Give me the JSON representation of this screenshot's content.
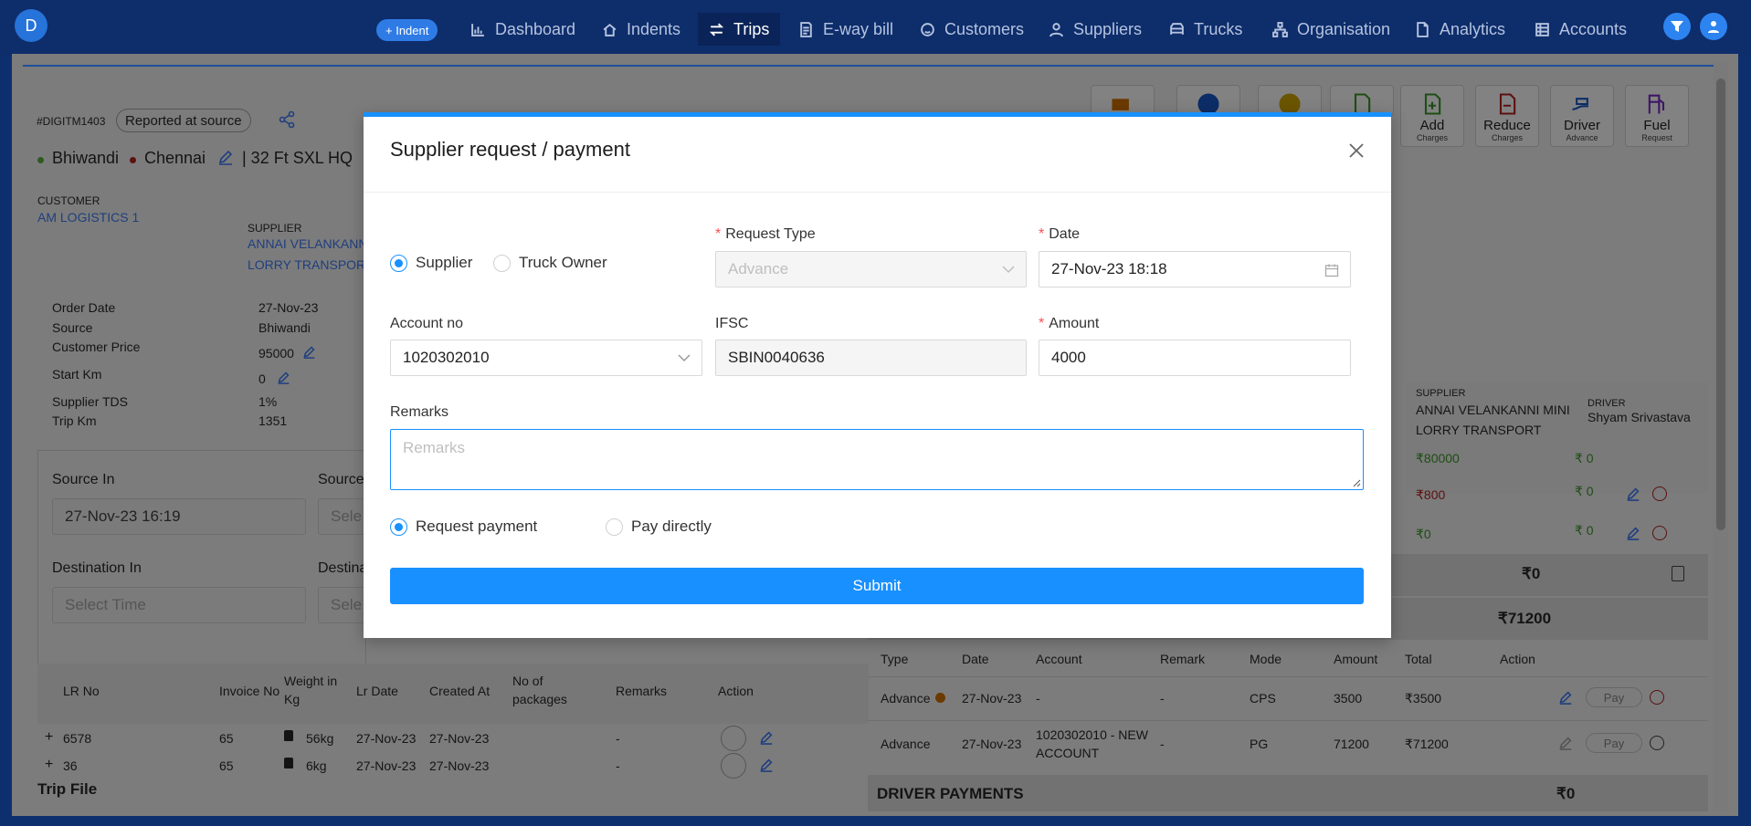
{
  "nav": {
    "avatar_letter": "D",
    "indent_button": "+ Indent",
    "items": [
      {
        "label": "Dashboard",
        "icon": "bar-chart-icon"
      },
      {
        "label": "Indents",
        "icon": "home-icon"
      },
      {
        "label": "Trips",
        "icon": "swap-icon"
      },
      {
        "label": "E-way bill",
        "icon": "document-icon"
      },
      {
        "label": "Customers",
        "icon": "smile-icon"
      },
      {
        "label": "Suppliers",
        "icon": "user-icon"
      },
      {
        "label": "Trucks",
        "icon": "truck-icon"
      },
      {
        "label": "Organisation",
        "icon": "org-icon"
      },
      {
        "label": "Analytics",
        "icon": "file-icon"
      },
      {
        "label": "Accounts",
        "icon": "table-icon"
      }
    ],
    "active": "Trips"
  },
  "trip": {
    "id": "#DIGITM1403",
    "status": "Reported at source",
    "source": "Bhiwandi",
    "destination": "Chennai",
    "truck_type": "| 32 Ft SXL HQ",
    "customer_label": "CUSTOMER",
    "customer": "AM LOGISTICS 1",
    "supplier_label": "SUPPLIER",
    "supplier_line1": "ANNAI VELANKANN",
    "supplier_line2": "LORRY TRANSPORT",
    "details": [
      {
        "label": "Order Date",
        "value": "27-Nov-23"
      },
      {
        "label": "Source",
        "value": "Bhiwandi"
      },
      {
        "label": "Customer Price",
        "value": "95000"
      },
      {
        "label": "Start Km",
        "value": "0"
      },
      {
        "label": "Supplier TDS",
        "value": "1%"
      },
      {
        "label": "Trip Km",
        "value": "1351"
      }
    ],
    "source_in_label": "Source In",
    "source_in_value": "27-Nov-23 16:19",
    "source_out_label": "Source",
    "source_out_placeholder": "Sele",
    "dest_in_label": "Destination In",
    "dest_in_placeholder": "Select Time",
    "dest_out_label": "Destina",
    "dest_out_placeholder": "Sele",
    "trip_file": "Trip File"
  },
  "lr_table": {
    "headers": [
      "LR No",
      "Invoice No",
      "Weight in Kg",
      "Lr Date",
      "Created At",
      "No of packages",
      "Remarks",
      "Action"
    ],
    "rows": [
      {
        "lr": "6578",
        "invoice": "65",
        "weight": "56kg",
        "lr_date": "27-Nov-23",
        "created": "27-Nov-23",
        "remarks": "-"
      },
      {
        "lr": "36",
        "invoice": "65",
        "weight": "6kg",
        "lr_date": "27-Nov-23",
        "created": "27-Nov-23",
        "remarks": "-"
      }
    ]
  },
  "tools": [
    {
      "label": "Add",
      "sub": "Charges"
    },
    {
      "label": "Reduce",
      "sub": "Charges"
    },
    {
      "label": "Driver",
      "sub": "Advance"
    },
    {
      "label": "Fuel",
      "sub": "Request"
    }
  ],
  "right_panel": {
    "supplier_label": "SUPPLIER",
    "supplier_name": "ANNAI VELANKANNI MINI LORRY TRANSPORT",
    "driver_label": "DRIVER",
    "driver_name": "Shyam Srivastava",
    "rows": [
      {
        "supplier": "₹80000",
        "driver": "₹ 0"
      },
      {
        "supplier": "₹800",
        "driver": "₹ 0"
      },
      {
        "supplier": "₹0",
        "driver": "₹ 0"
      }
    ],
    "total1": "₹0",
    "total2": "₹71200"
  },
  "payments_table": {
    "headers": [
      "Type",
      "Date",
      "Account",
      "Remark",
      "Mode",
      "Amount",
      "Total",
      "Action"
    ],
    "rows": [
      {
        "type": "Advance",
        "date": "27-Nov-23",
        "account": "-",
        "remark": "-",
        "mode": "CPS",
        "amount": "3500",
        "total": "₹3500",
        "action": "Pay"
      },
      {
        "type": "Advance",
        "date": "27-Nov-23",
        "account": "1020302010 - NEW ACCOUNT",
        "remark": "-",
        "mode": "PG",
        "amount": "71200",
        "total": "₹71200",
        "action": "Pay"
      }
    ],
    "driver_payments_label": "DRIVER PAYMENTS",
    "driver_payments_total": "₹0"
  },
  "modal": {
    "title": "Supplier request / payment",
    "party_options": [
      "Supplier",
      "Truck Owner"
    ],
    "party_selected": "Supplier",
    "request_type_label": "Request Type",
    "request_type_value": "Advance",
    "date_label": "Date",
    "date_value": "27-Nov-23 18:18",
    "account_label": "Account no",
    "account_value": "1020302010",
    "ifsc_label": "IFSC",
    "ifsc_value": "SBIN0040636",
    "amount_label": "Amount",
    "amount_value": "4000",
    "remarks_label": "Remarks",
    "remarks_placeholder": "Remarks",
    "payment_options": [
      "Request payment",
      "Pay directly"
    ],
    "payment_selected": "Request payment",
    "submit_label": "Submit"
  },
  "colors": {
    "nav_bg": "#0e2d6b",
    "primary": "#1890ff",
    "required": "#ff4d4f"
  }
}
